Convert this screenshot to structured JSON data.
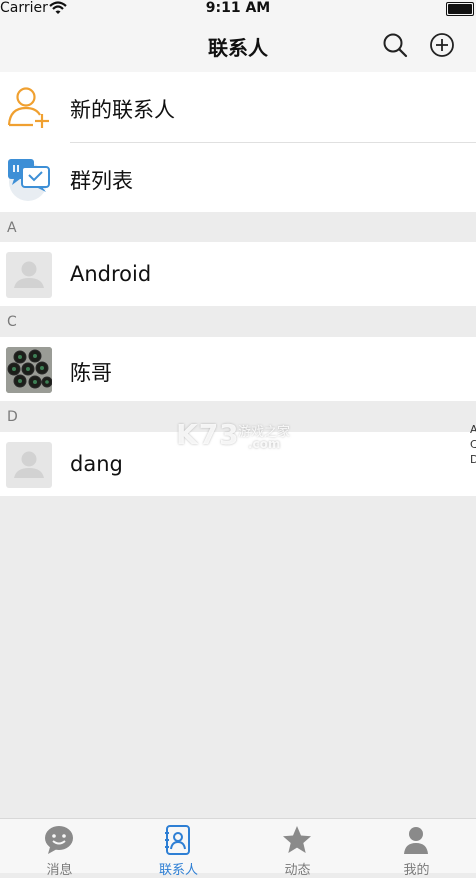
{
  "status_bar": {
    "carrier": "Carrier",
    "time": "9:11 AM"
  },
  "nav": {
    "title": "联系人",
    "search_icon": "search-icon",
    "add_icon": "plus-circle-icon"
  },
  "top_actions": [
    {
      "label": "新的联系人",
      "icon": "add-user-icon"
    },
    {
      "label": "群列表",
      "icon": "group-chat-icon"
    }
  ],
  "sections": [
    {
      "letter": "A",
      "contacts": [
        {
          "name": "Android",
          "avatar": "default-avatar"
        }
      ]
    },
    {
      "letter": "C",
      "contacts": [
        {
          "name": "陈哥",
          "avatar": "photo-avatar"
        }
      ]
    },
    {
      "letter": "D",
      "contacts": [
        {
          "name": "dang",
          "avatar": "default-avatar"
        }
      ]
    }
  ],
  "side_index": [
    "A",
    "C",
    "D"
  ],
  "watermark": {
    "main": "K73",
    "sub": "游戏之家",
    "domain": ".com"
  },
  "tabs": [
    {
      "label": "消息",
      "icon": "chat-bubble-icon",
      "active": false
    },
    {
      "label": "联系人",
      "icon": "contacts-book-icon",
      "active": true
    },
    {
      "label": "动态",
      "icon": "star-icon",
      "active": false
    },
    {
      "label": "我的",
      "icon": "person-icon",
      "active": false
    }
  ],
  "colors": {
    "accent": "#2e7fd4",
    "add_contact_orange": "#f0a030",
    "group_blue": "#3d8fd6",
    "background": "#ececec"
  }
}
